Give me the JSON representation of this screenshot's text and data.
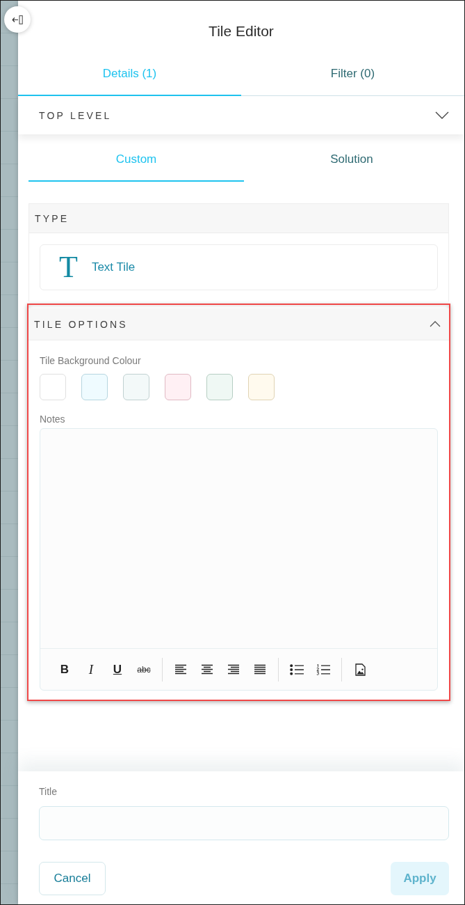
{
  "header": {
    "title": "Tile Editor"
  },
  "tabs": [
    {
      "label": "Details (1)",
      "selected": true
    },
    {
      "label": "Filter (0)",
      "selected": false
    }
  ],
  "level_selector": {
    "label": "TOP LEVEL",
    "expanded": false
  },
  "source_tabs": [
    {
      "label": "Custom",
      "selected": true
    },
    {
      "label": "Solution",
      "selected": false
    }
  ],
  "type_section": {
    "heading": "TYPE",
    "options": [
      {
        "glyph": "T",
        "label": "Text Tile"
      }
    ]
  },
  "tile_options": {
    "heading": "TILE OPTIONS",
    "expanded": true,
    "highlighted": true,
    "colour_label": "Tile Background Colour",
    "colours": [
      {
        "color": "#ffffff",
        "selected": false
      },
      {
        "color": "#effbff",
        "selected": false
      },
      {
        "color": "#f3f9f9",
        "selected": false
      },
      {
        "color": "#fff0f4",
        "selected": false
      },
      {
        "color": "#eff8f4",
        "selected": false
      },
      {
        "color": "#fffaee",
        "selected": false
      }
    ],
    "notes_label": "Notes",
    "toolbar": [
      [
        {
          "kind": "bold",
          "label": "B"
        },
        {
          "kind": "italic",
          "label": "I"
        },
        {
          "kind": "underline",
          "label": "U"
        },
        {
          "kind": "strikethrough",
          "label": "abc"
        }
      ],
      [
        {
          "kind": "align-left"
        },
        {
          "kind": "align-center"
        },
        {
          "kind": "align-right"
        },
        {
          "kind": "justify"
        }
      ],
      [
        {
          "kind": "bullet-list"
        },
        {
          "kind": "numbered-list"
        }
      ],
      [
        {
          "kind": "image"
        }
      ]
    ]
  },
  "footer": {
    "title_label": "Title",
    "buttons": [
      {
        "kind": "cancel",
        "label": "Cancel",
        "disabled": false
      },
      {
        "kind": "apply",
        "label": "Apply",
        "disabled": true
      }
    ]
  }
}
